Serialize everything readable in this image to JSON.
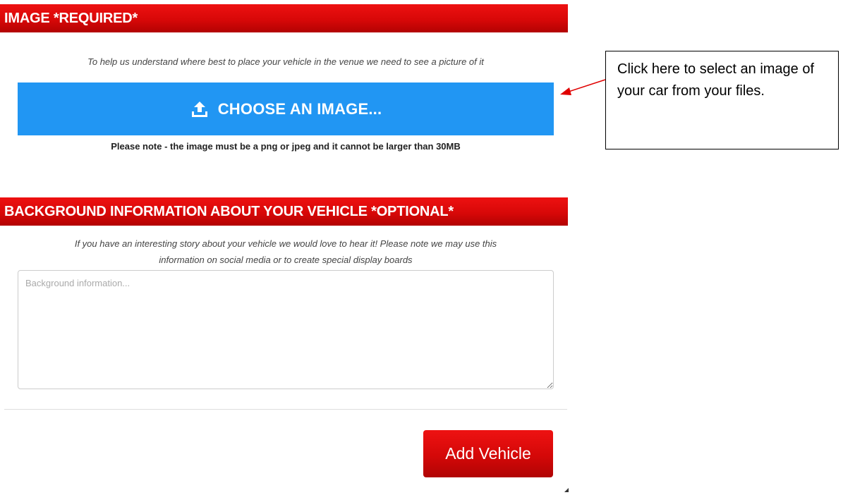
{
  "image_section": {
    "header": "IMAGE *REQUIRED*",
    "help_text": "To help us understand where best to place your vehicle in the venue we need to see a picture of it",
    "choose_button_label": "CHOOSE AN IMAGE...",
    "upload_icon": "upload-icon",
    "note": "Please note - the image must be a png or jpeg and it cannot be larger than 30MB"
  },
  "background_section": {
    "header": "BACKGROUND INFORMATION ABOUT YOUR VEHICLE *OPTIONAL*",
    "help_text_line1": "If you have an interesting story about your vehicle we would love to hear it! Please note we may use this",
    "help_text_line2": "information on social media or to create special display boards",
    "textarea_placeholder": "Background information...",
    "textarea_value": ""
  },
  "actions": {
    "add_vehicle_label": "Add Vehicle"
  },
  "callout": {
    "text": "Click here to select an image of your car from your files."
  },
  "colors": {
    "header_red": "#d80808",
    "button_blue": "#2196f3",
    "arrow_red": "#e00000"
  }
}
